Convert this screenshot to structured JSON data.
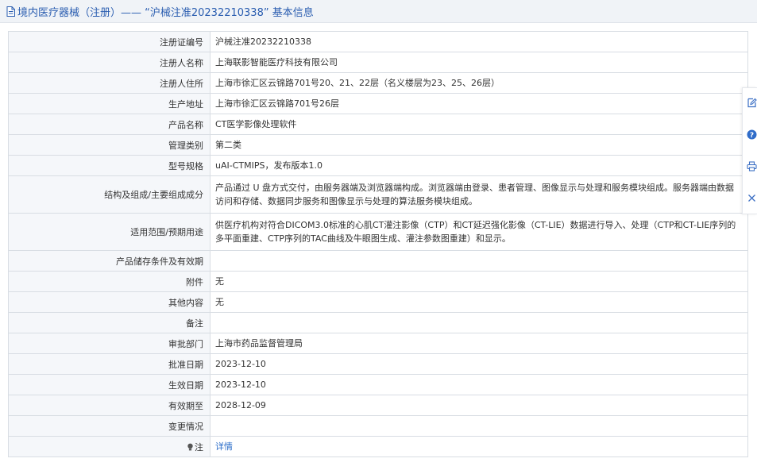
{
  "header": {
    "title": "境内医疗器械（注册）——  “沪械注准20232210338” 基本信息",
    "icon": "document-icon"
  },
  "rows": [
    {
      "label": "注册证编号",
      "value": "沪械注准20232210338"
    },
    {
      "label": "注册人名称",
      "value": "上海联影智能医疗科技有限公司"
    },
    {
      "label": "注册人住所",
      "value": "上海市徐汇区云锦路701号20、21、22层（名义楼层为23、25、26层）"
    },
    {
      "label": "生产地址",
      "value": "上海市徐汇区云锦路701号26层"
    },
    {
      "label": "产品名称",
      "value": "CT医学影像处理软件"
    },
    {
      "label": "管理类别",
      "value": "第二类"
    },
    {
      "label": "型号规格",
      "value": "uAI-CTMIPS，发布版本1.0"
    },
    {
      "label": "结构及组成/主要组成成分",
      "value": "产品通过 U 盘方式交付，由服务器端及浏览器端构成。浏览器端由登录、患者管理、图像显示与处理和服务模块组成。服务器端由数据访问和存储、数据同步服务和图像显示与处理的算法服务模块组成。"
    },
    {
      "label": "适用范围/预期用途",
      "value": "供医疗机构对符合DICOM3.0标准的心肌CT灌注影像（CTP）和CT延迟强化影像（CT-LIE）数据进行导入、处理（CTP和CT-LIE序列的多平面重建、CTP序列的TAC曲线及牛眼图生成、灌注参数图重建）和显示。"
    },
    {
      "label": "产品储存条件及有效期",
      "value": ""
    },
    {
      "label": "附件",
      "value": "无"
    },
    {
      "label": "其他内容",
      "value": "无"
    },
    {
      "label": "备注",
      "value": ""
    },
    {
      "label": "审批部门",
      "value": "上海市药品监督管理局"
    },
    {
      "label": "批准日期",
      "value": "2023-12-10"
    },
    {
      "label": "生效日期",
      "value": "2023-12-10"
    },
    {
      "label": "有效期至",
      "value": "2028-12-09"
    },
    {
      "label": "变更情况",
      "value": ""
    },
    {
      "label": "注",
      "value": "详情"
    }
  ],
  "toolbar": {
    "items": [
      "edit-icon",
      "help-icon",
      "print-icon",
      "close-icon"
    ]
  },
  "colors": {
    "accent": "#2a5db0",
    "link": "#2a6cc9",
    "label_bg": "#f5f7fa",
    "border": "#d8dde3"
  }
}
